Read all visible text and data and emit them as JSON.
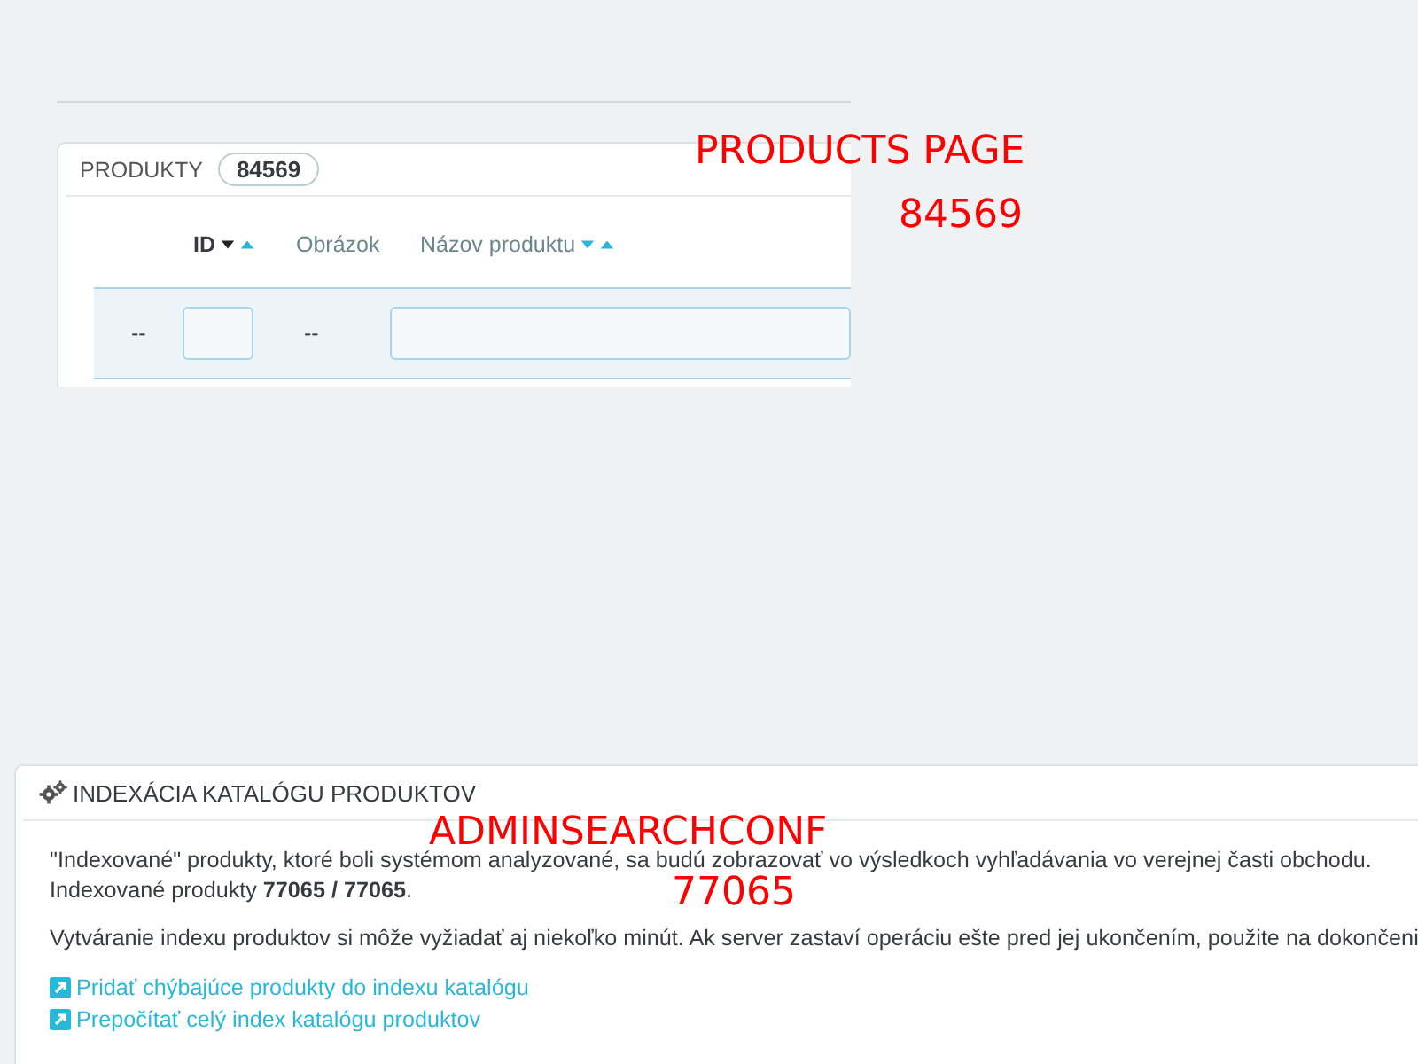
{
  "products_panel": {
    "title": "PRODUKTY",
    "count": "84569",
    "columns": [
      {
        "label": "ID",
        "sortable": true,
        "selected": true
      },
      {
        "label": "Obrázok",
        "sortable": false,
        "selected": false
      },
      {
        "label": "Názov produktu",
        "sortable": true,
        "selected": false
      }
    ],
    "filter_row": {
      "col_1": "--",
      "col_3": "--"
    }
  },
  "annotations": [
    "PRODUCTS PAGE",
    "84569",
    "ADMINSEARCHCONF",
    "77065"
  ],
  "index_panel": {
    "title": "INDEXÁCIA KATALÓGU PRODUKTOV",
    "paragraphs": [
      [
        "\"Indexované\" produkty, ktoré boli systémom analyzované, sa budú zobrazovať vo výsledkoch vyhľadávania vo verejnej časti obchodu.",
        "Indexované produkty **77065 / 77065**."
      ],
      [
        "Vytváranie indexu produktov si môže vyžiadať aj niekoľko minút. Ak server zastaví operáciu ešte pred jej ukončením, použite na dokončeni"
      ]
    ],
    "links": [
      "Pridať chýbajúce produkty do indexu katalógu",
      "Prepočítať celý index katalógu produktov"
    ]
  }
}
